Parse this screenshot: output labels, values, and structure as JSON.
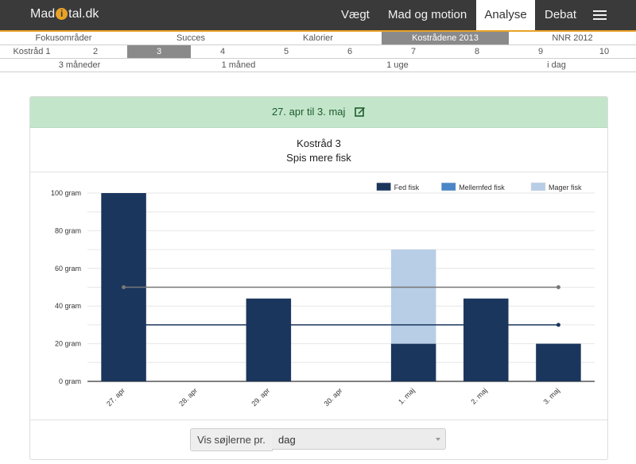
{
  "header": {
    "logo": {
      "before": "Mad",
      "dot": "i",
      "after": "tal.dk"
    },
    "nav": [
      "Vægt",
      "Mad og motion",
      "Analyse",
      "Debat"
    ],
    "active_nav": "Analyse",
    "menu_icon": "hamburger-menu-icon"
  },
  "tabs_row1": {
    "items": [
      "Fokusområder",
      "Succes",
      "Kalorier",
      "Kostrådene 2013",
      "NNR 2012"
    ],
    "selected": "Kostrådene 2013"
  },
  "tabs_row2": {
    "items": [
      "Kostråd 1",
      "2",
      "3",
      "4",
      "5",
      "6",
      "7",
      "8",
      "9",
      "10"
    ],
    "selected": "3"
  },
  "tabs_row3": {
    "items": [
      "3 måneder",
      "1 måned",
      "1 uge",
      "i dag"
    ]
  },
  "panel": {
    "date_range": "27. apr til 3. maj",
    "edit_icon": "edit-icon",
    "title": "Kostråd 3",
    "subtitle": "Spis mere fisk"
  },
  "chart_data": {
    "type": "bar",
    "stacked": true,
    "categories": [
      "27. apr",
      "28. apr",
      "29. apr",
      "30. apr",
      "1. maj",
      "2. maj",
      "3. maj"
    ],
    "series": [
      {
        "name": "Fed fisk",
        "color": "#1b365d",
        "values": [
          100,
          0,
          44,
          0,
          20,
          44,
          20
        ]
      },
      {
        "name": "Mellemfed fisk",
        "color": "#4a86c8",
        "values": [
          0,
          0,
          0,
          0,
          0,
          0,
          0
        ]
      },
      {
        "name": "Mager fisk",
        "color": "#b8cde6",
        "values": [
          0,
          0,
          0,
          0,
          50,
          0,
          0
        ]
      }
    ],
    "reference_lines": [
      {
        "color": "#777777",
        "value": 50
      },
      {
        "color": "#1b365d",
        "value": 30
      }
    ],
    "y_tick_labels": [
      "0 gram",
      "20 gram",
      "40 gram",
      "60 gram",
      "80 gram",
      "100 gram"
    ],
    "y_ticks": [
      0,
      20,
      40,
      60,
      80,
      100
    ],
    "ylim": [
      0,
      100
    ],
    "legend_position": "top-right",
    "grid": true
  },
  "footer": {
    "label": "Vis søjlerne pr.",
    "value": "dag"
  }
}
